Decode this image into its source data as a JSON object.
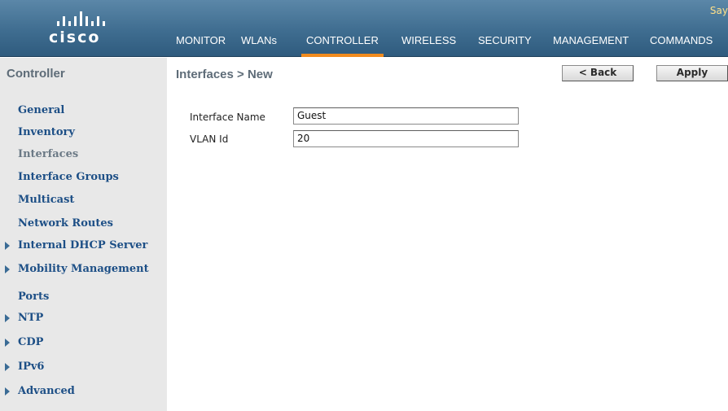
{
  "header": {
    "brand": "cisco",
    "top_right_text": "Say",
    "nav": [
      {
        "label": "MONITOR"
      },
      {
        "label": "WLANs"
      },
      {
        "label": "CONTROLLER",
        "active": true
      },
      {
        "label": "WIRELESS"
      },
      {
        "label": "SECURITY"
      },
      {
        "label": "MANAGEMENT"
      },
      {
        "label": "COMMANDS"
      }
    ]
  },
  "sidebar": {
    "title": "Controller",
    "items": [
      {
        "label": "General",
        "expandable": false
      },
      {
        "label": "Inventory",
        "expandable": false
      },
      {
        "label": "Interfaces",
        "expandable": false,
        "selected": true
      },
      {
        "label": "Interface Groups",
        "expandable": false
      },
      {
        "label": "Multicast",
        "expandable": false
      },
      {
        "label": "Network Routes",
        "expandable": false
      },
      {
        "label": "Internal DHCP Server",
        "expandable": true
      },
      {
        "label": "Mobility Management",
        "expandable": true
      },
      {
        "label": "Ports",
        "expandable": false
      },
      {
        "label": "NTP",
        "expandable": true
      },
      {
        "label": "CDP",
        "expandable": true
      },
      {
        "label": "IPv6",
        "expandable": true
      },
      {
        "label": "Advanced",
        "expandable": true
      }
    ]
  },
  "main": {
    "title": "Interfaces > New",
    "back_label": "< Back",
    "apply_label": "Apply",
    "fields": {
      "interface_name": {
        "label": "Interface Name",
        "value": "Guest"
      },
      "vlan_id": {
        "label": "VLAN Id",
        "value": "20"
      }
    }
  },
  "colors": {
    "header_blue": "#3f6d90",
    "active_tab_accent": "#f08b1e",
    "sidebar_bg": "#e8e8e8",
    "sidebar_link": "#1d4f86"
  }
}
